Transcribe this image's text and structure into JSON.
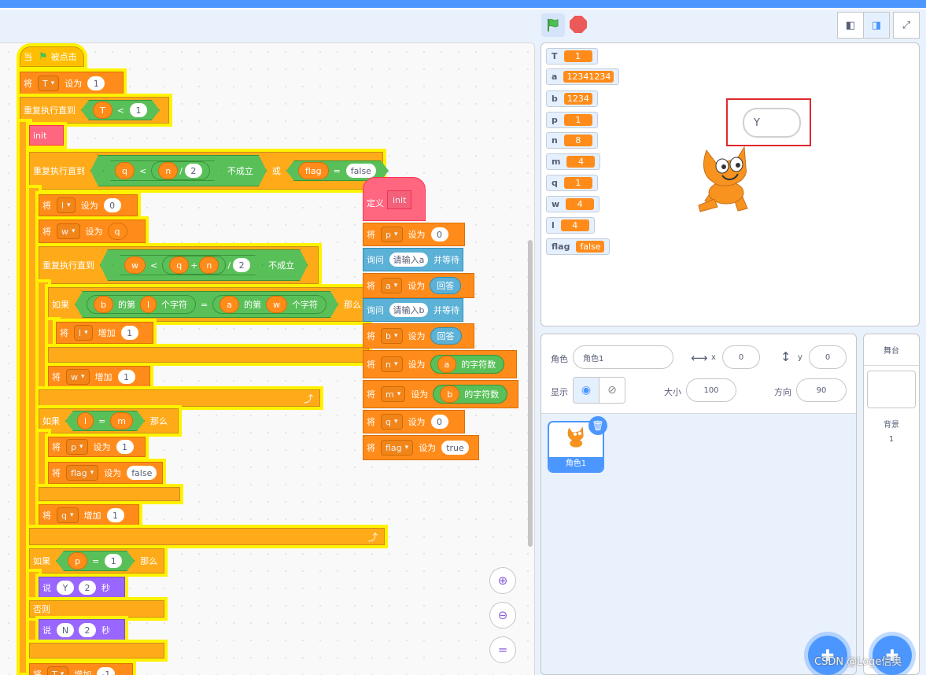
{
  "colors": {
    "accent": "#4c97ff",
    "events": "#ffbf00",
    "variables": "#ff8c1a",
    "control": "#ffab19",
    "operators": "#59c059",
    "looks": "#9966ff",
    "sensing": "#5cb1d6",
    "custom": "#ff6680"
  },
  "scripts": {
    "hat": {
      "when": "当",
      "clicked": "被点击"
    },
    "set_T": {
      "set": "将",
      "var": "T",
      "to": "设为",
      "val": "1"
    },
    "repeat_until": {
      "label": "重复执行直到",
      "left": "T",
      "op": "<",
      "right": "1"
    },
    "init_call": "init",
    "repeat2": {
      "label": "重复执行直到",
      "q": "q",
      "lt": "<",
      "n": "n",
      "div": "/",
      "two": "2",
      "not": "不成立",
      "or": "或",
      "flag": "flag",
      "eq": "=",
      "false": "false"
    },
    "set_l": {
      "set": "将",
      "var": "l",
      "to": "设为",
      "val": "0"
    },
    "set_w": {
      "set": "将",
      "var": "w",
      "to": "设为",
      "val": "q"
    },
    "repeat3": {
      "label": "重复执行直到",
      "w": "w",
      "lt": "<",
      "q": "q",
      "plus": "+",
      "n": "n",
      "div": "/",
      "two": "2",
      "not": "不成立"
    },
    "if1": {
      "if": "如果",
      "b": "b",
      "of1": "的第",
      "l": "l",
      "char1": "个字符",
      "eq": "=",
      "a": "a",
      "of2": "的第",
      "w": "w",
      "char2": "个字符",
      "then": "那么"
    },
    "inc_l": {
      "set": "将",
      "var": "l",
      "by": "增加",
      "val": "1"
    },
    "inc_w": {
      "set": "将",
      "var": "w",
      "by": "增加",
      "val": "1"
    },
    "if2": {
      "if": "如果",
      "l": "l",
      "eq": "=",
      "m": "m",
      "then": "那么"
    },
    "set_p": {
      "set": "将",
      "var": "p",
      "to": "设为",
      "val": "1"
    },
    "set_flag": {
      "set": "将",
      "var": "flag",
      "to": "设为",
      "val": "false"
    },
    "inc_q": {
      "set": "将",
      "var": "q",
      "by": "增加",
      "val": "1"
    },
    "if3": {
      "if": "如果",
      "p": "p",
      "eq": "=",
      "one": "1",
      "then": "那么"
    },
    "say_y": {
      "say": "说",
      "text": "Y",
      "secs": "2",
      "unit": "秒"
    },
    "else": "否则",
    "say_n": {
      "say": "说",
      "text": "N",
      "secs": "2",
      "unit": "秒"
    },
    "inc_T": {
      "set": "将",
      "var": "T",
      "by": "增加",
      "val": "-1"
    }
  },
  "define": {
    "define": "定义",
    "name": "init",
    "set_p": {
      "set": "将",
      "var": "p",
      "to": "设为",
      "val": "0"
    },
    "ask_a": {
      "ask": "询问",
      "text": "请输入a",
      "wait": "并等待"
    },
    "set_a": {
      "set": "将",
      "var": "a",
      "to": "设为",
      "val": "回答"
    },
    "ask_b": {
      "ask": "询问",
      "text": "请输入b",
      "wait": "并等待"
    },
    "set_b": {
      "set": "将",
      "var": "b",
      "to": "设为",
      "val": "回答"
    },
    "set_n": {
      "set": "将",
      "var": "n",
      "to": "设为",
      "of": "a",
      "len": "的字符数"
    },
    "set_m": {
      "set": "将",
      "var": "m",
      "to": "设为",
      "of": "b",
      "len": "的字符数"
    },
    "set_q": {
      "set": "将",
      "var": "q",
      "to": "设为",
      "val": "0"
    },
    "set_flag": {
      "set": "将",
      "var": "flag",
      "to": "设为",
      "val": "true"
    }
  },
  "monitors": [
    {
      "name": "T",
      "value": "1"
    },
    {
      "name": "a",
      "value": "12341234"
    },
    {
      "name": "b",
      "value": "1234"
    },
    {
      "name": "p",
      "value": "1"
    },
    {
      "name": "n",
      "value": "8"
    },
    {
      "name": "m",
      "value": "4"
    },
    {
      "name": "q",
      "value": "1"
    },
    {
      "name": "w",
      "value": "4"
    },
    {
      "name": "l",
      "value": "4"
    },
    {
      "name": "flag",
      "value": "false"
    }
  ],
  "speech": "Y",
  "sprite_info": {
    "sprite_label": "角色",
    "sprite_name": "角色1",
    "x_label": "x",
    "x": "0",
    "y_label": "y",
    "y": "0",
    "show_label": "显示",
    "size_label": "大小",
    "size": "100",
    "direction_label": "方向",
    "direction": "90"
  },
  "sprite_tile": {
    "name": "角色1"
  },
  "stage_panel": {
    "title": "舞台",
    "backdrops_label": "背景",
    "backdrops_count": "1"
  },
  "watermark": "CSDN @Loge信奥",
  "icons": [
    "green-flag-icon",
    "stop-icon",
    "small-stage-icon",
    "large-stage-icon",
    "fullscreen-icon",
    "zoom-in-icon",
    "zoom-out-icon",
    "zoom-reset-icon",
    "eye-icon",
    "eye-off-icon",
    "trash-icon",
    "add-sprite-icon",
    "add-backdrop-icon",
    "turn-arrow-icon"
  ]
}
